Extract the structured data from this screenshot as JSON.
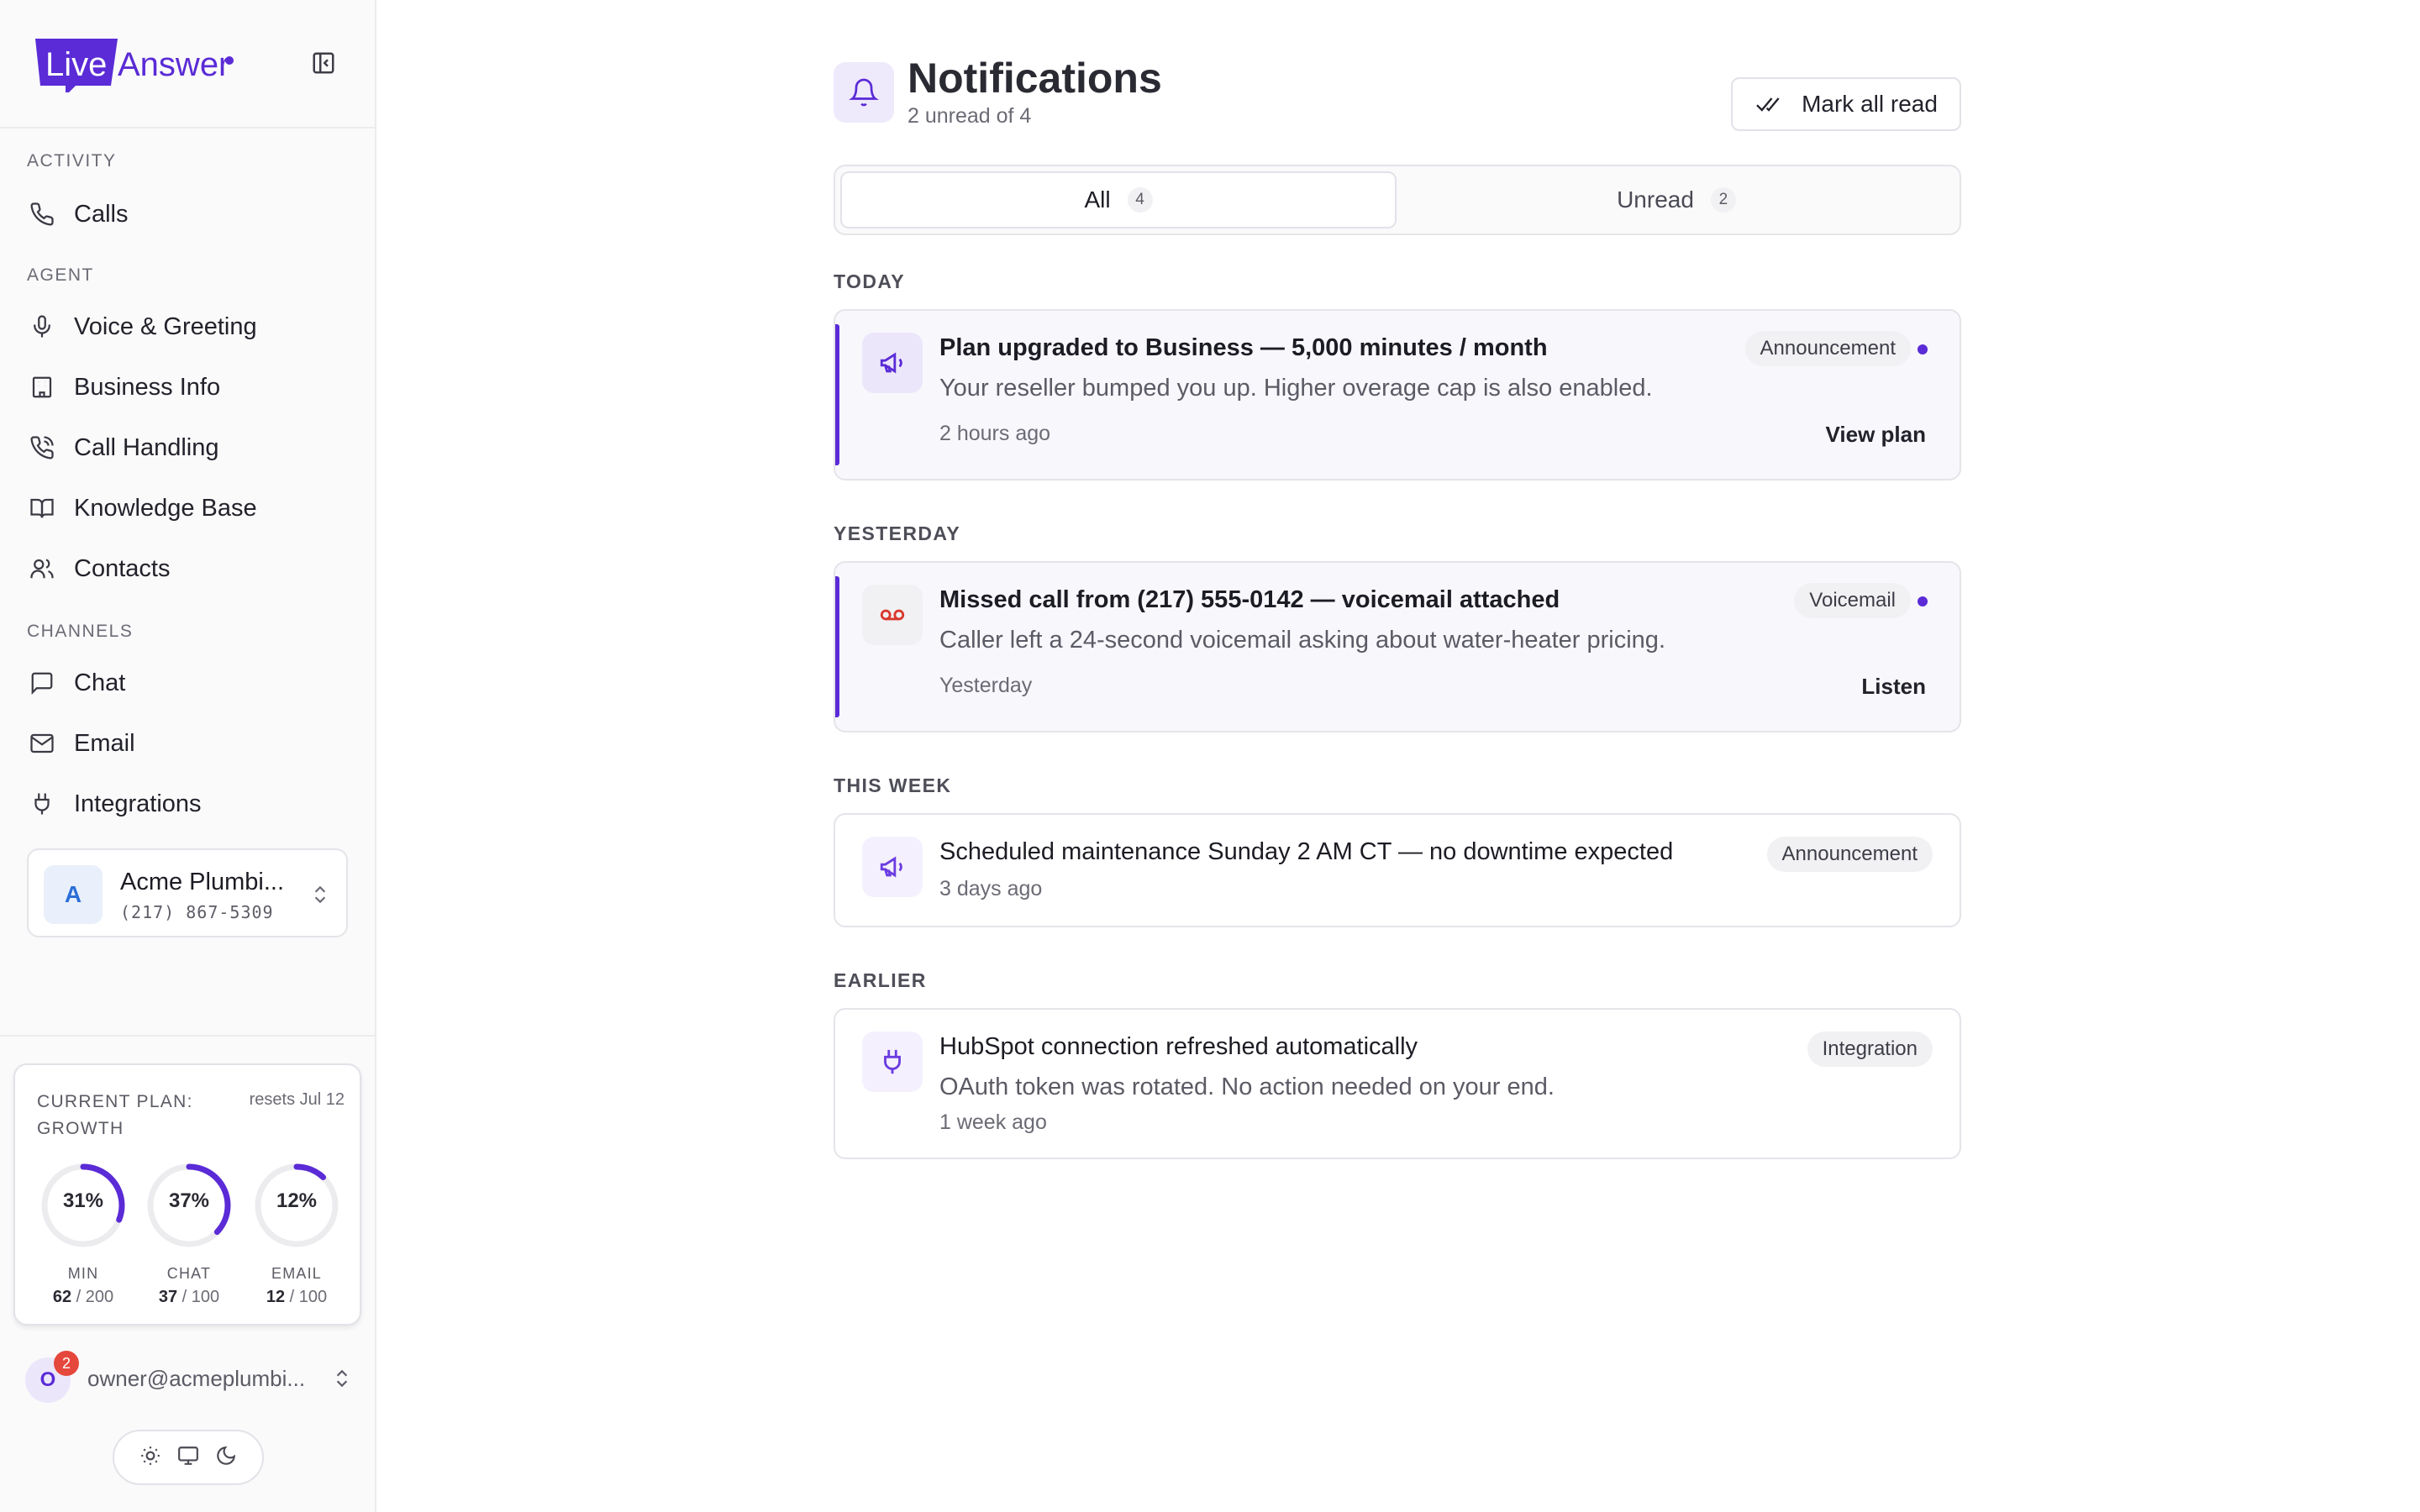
{
  "brand": {
    "name_part1": "Live",
    "name_part2": "Answer",
    "primary_color": "#5a2bd6"
  },
  "sidebar": {
    "sections": [
      {
        "label": "ACTIVITY"
      },
      {
        "label": "AGENT"
      },
      {
        "label": "CHANNELS"
      }
    ],
    "items": [
      {
        "label": "Calls",
        "icon": "phone-icon"
      },
      {
        "label": "Voice & Greeting",
        "icon": "microphone-icon"
      },
      {
        "label": "Business Info",
        "icon": "building-icon"
      },
      {
        "label": "Call Handling",
        "icon": "phone-forward-icon"
      },
      {
        "label": "Knowledge Base",
        "icon": "book-icon"
      },
      {
        "label": "Contacts",
        "icon": "users-icon"
      },
      {
        "label": "Chat",
        "icon": "message-icon"
      },
      {
        "label": "Email",
        "icon": "mail-icon"
      },
      {
        "label": "Integrations",
        "icon": "plug-icon"
      }
    ],
    "account": {
      "initial": "A",
      "name": "Acme Plumbi...",
      "phone": "(217) 867-5309"
    },
    "plan": {
      "title": "CURRENT PLAN: GROWTH",
      "resets": "resets Jul 12",
      "gauges": [
        {
          "pct_label": "31%",
          "fraction": 0.31,
          "name": "MIN",
          "used": "62",
          "limit": "/ 200"
        },
        {
          "pct_label": "37%",
          "fraction": 0.37,
          "name": "CHAT",
          "used": "37",
          "limit": "/ 100"
        },
        {
          "pct_label": "12%",
          "fraction": 0.12,
          "name": "EMAIL",
          "used": "12",
          "limit": "/ 100"
        }
      ]
    },
    "user": {
      "initial": "O",
      "badge": "2",
      "email": "owner@acmeplumbi..."
    }
  },
  "main": {
    "title": "Notifications",
    "subtitle": "2 unread of 4",
    "mark_all_read": "Mark all read",
    "tabs": [
      {
        "label": "All",
        "count": "4"
      },
      {
        "label": "Unread",
        "count": "2"
      }
    ],
    "groups": [
      {
        "label": "TODAY",
        "items": [
          {
            "title": "Plan upgraded to Business — 5,000 minutes / month",
            "body": "Your reseller bumped you up. Higher overage cap is also enabled.",
            "time": "2 hours ago",
            "tag": "Announcement",
            "action": "View plan",
            "icon": "megaphone-icon"
          }
        ]
      },
      {
        "label": "YESTERDAY",
        "items": [
          {
            "title": "Missed call from (217) 555-0142 — voicemail attached",
            "body": "Caller left a 24-second voicemail asking about water-heater pricing.",
            "time": "Yesterday",
            "tag": "Voicemail",
            "action": "Listen",
            "icon": "voicemail-icon"
          }
        ]
      },
      {
        "label": "THIS WEEK",
        "items": [
          {
            "title": "Scheduled maintenance Sunday 2 AM CT — no downtime expected",
            "time": "3 days ago",
            "tag": "Announcement",
            "icon": "megaphone-icon"
          }
        ]
      },
      {
        "label": "EARLIER",
        "items": [
          {
            "title": "HubSpot connection refreshed automatically",
            "body": "OAuth token was rotated. No action needed on your end.",
            "time": "1 week ago",
            "tag": "Integration",
            "icon": "plug-icon"
          }
        ]
      }
    ]
  }
}
